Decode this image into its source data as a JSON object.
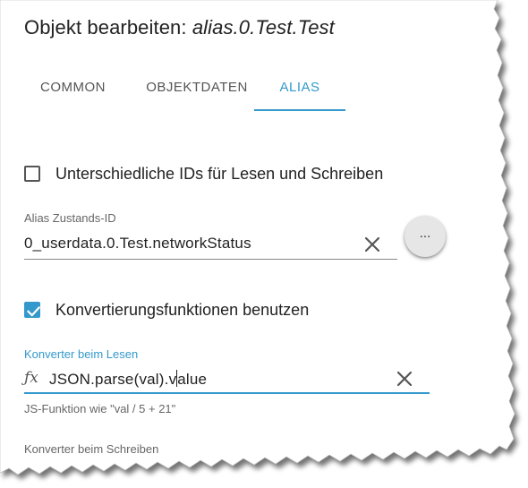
{
  "dialog": {
    "title_prefix": "Objekt bearbeiten:",
    "object_id": "alias.0.Test.Test"
  },
  "tabs": [
    {
      "label": "COMMON",
      "active": false
    },
    {
      "label": "OBJEKTDATEN",
      "active": false
    },
    {
      "label": "ALIAS",
      "active": true
    }
  ],
  "alias": {
    "separate_ids": {
      "label": "Unterschiedliche IDs für Lesen und Schreiben",
      "checked": false
    },
    "state_id": {
      "label": "Alias Zustands-ID",
      "value": "0_userdata.0.Test.networkStatus",
      "browse_label": "..."
    },
    "use_conversion": {
      "label": "Konvertierungsfunktionen benutzen",
      "checked": true
    },
    "read_converter": {
      "label": "Konverter beim Lesen",
      "value_before_caret": "JSON.parse(val).v",
      "value_after_caret": "alue",
      "helper": "JS-Funktion wie \"val / 5 + 21\""
    },
    "write_converter": {
      "label": "Konverter beim Schreiben"
    }
  },
  "colors": {
    "accent": "#3399cc",
    "text": "#222222",
    "muted": "#666666"
  },
  "icons": {
    "clear": "close-icon",
    "function": "fx-icon",
    "check": "check-icon"
  }
}
